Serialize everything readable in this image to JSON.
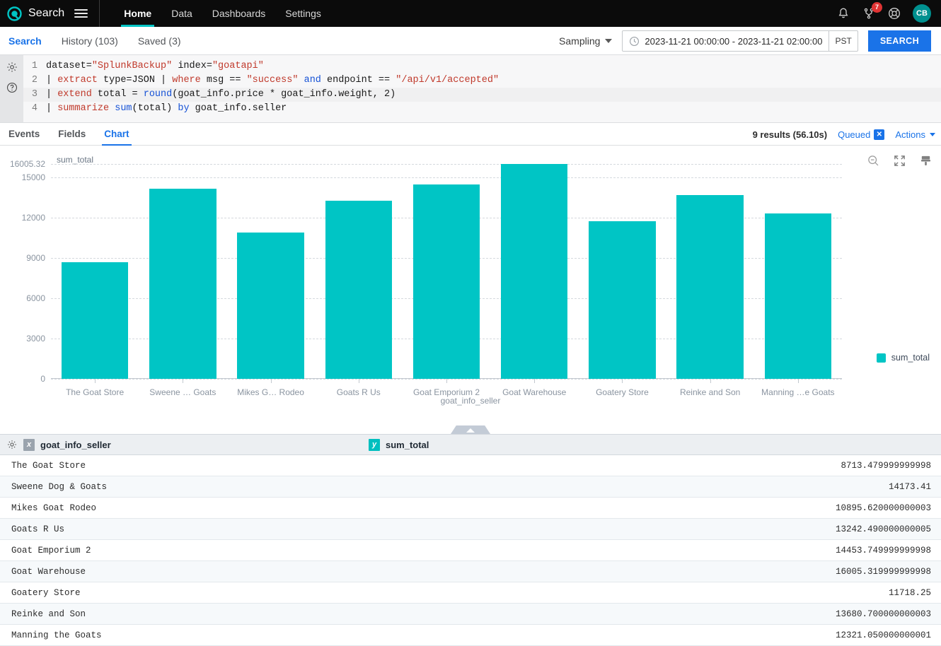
{
  "topnav": {
    "brand": "Search",
    "menu": [
      {
        "label": "Home",
        "active": true
      },
      {
        "label": "Data",
        "active": false
      },
      {
        "label": "Dashboards",
        "active": false
      },
      {
        "label": "Settings",
        "active": false
      }
    ],
    "notification_badge": "7",
    "avatar_initials": "CB",
    "icons": [
      "bell-icon",
      "activity-branch-icon",
      "help-lifebuoy-icon"
    ]
  },
  "subbar": {
    "tabs": [
      {
        "label": "Search",
        "active": true
      },
      {
        "label": "History (103)",
        "active": false
      },
      {
        "label": "Saved (3)",
        "active": false
      }
    ],
    "sampling_label": "Sampling",
    "time_range": "2023-11-21 00:00:00 - 2023-11-21 02:00:00",
    "timezone": "PST",
    "search_button": "SEARCH"
  },
  "editor": {
    "lines": [
      {
        "number": "1",
        "highlighted": false
      },
      {
        "number": "2",
        "highlighted": false
      },
      {
        "number": "3",
        "highlighted": true
      },
      {
        "number": "4",
        "highlighted": false
      }
    ],
    "query_text": "dataset=\"SplunkBackup\" index=\"goatapi\"\n| extract type=JSON | where msg == \"success\" and endpoint == \"/api/v1/accepted\"\n| extend total = round(goat_info.price * goat_info.weight, 2)\n| summarize sum(total) by goat_info.seller"
  },
  "results": {
    "tabs": [
      {
        "label": "Events",
        "active": false
      },
      {
        "label": "Fields",
        "active": false
      },
      {
        "label": "Chart",
        "active": true
      }
    ],
    "result_count": "9 results (56.10s)",
    "queued_label": "Queued",
    "queued_close": "✕",
    "actions_label": "Actions"
  },
  "chart_data": {
    "type": "bar",
    "title": "",
    "ylabel": "sum_total",
    "xlabel": "goat_info_seller",
    "ylim": [
      0,
      16005.32
    ],
    "yticks": [
      "0",
      "3000",
      "6000",
      "9000",
      "12000",
      "15000",
      "16005.32"
    ],
    "ytick_values": [
      0,
      3000,
      6000,
      9000,
      12000,
      15000,
      16005.32
    ],
    "grid": true,
    "legend": [
      "sum_total"
    ],
    "legend_position": "right",
    "color": "#00c5c5",
    "categories": [
      "The Goat Store",
      "Sweene … Goats",
      "Mikes G… Rodeo",
      "Goats R Us",
      "Goat Emporium 2",
      "Goat Warehouse",
      "Goatery Store",
      "Reinke and Son",
      "Manning …e Goats"
    ],
    "values": [
      8713.479999999998,
      14173.41,
      10895.620000000003,
      13242.490000000005,
      14453.749999999998,
      16005.319999999998,
      11718.25,
      13680.700000000003,
      12321.050000000001
    ]
  },
  "table": {
    "columns": [
      {
        "label": "goat_info_seller",
        "axis": "x"
      },
      {
        "label": "sum_total",
        "axis": "y"
      }
    ],
    "rows": [
      {
        "seller": "The Goat Store",
        "value": "8713.479999999998"
      },
      {
        "seller": "Sweene Dog & Goats",
        "value": "14173.41"
      },
      {
        "seller": "Mikes Goat Rodeo",
        "value": "10895.620000000003"
      },
      {
        "seller": "Goats R Us",
        "value": "13242.490000000005"
      },
      {
        "seller": "Goat Emporium 2",
        "value": "14453.749999999998"
      },
      {
        "seller": "Goat Warehouse",
        "value": "16005.319999999998"
      },
      {
        "seller": "Goatery Store",
        "value": "11718.25"
      },
      {
        "seller": "Reinke and Son",
        "value": "13680.700000000003"
      },
      {
        "seller": "Manning the Goats",
        "value": "12321.050000000001"
      }
    ]
  },
  "colors": {
    "accent_teal": "#00c5c5",
    "accent_blue": "#1a73e8",
    "nav_black": "#0b0b0b",
    "badge_red": "#e03434"
  }
}
